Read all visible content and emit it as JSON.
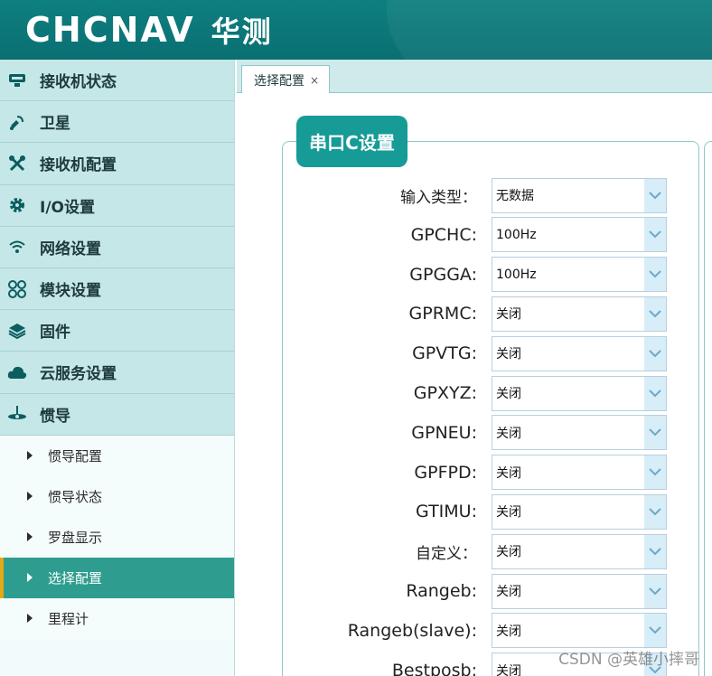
{
  "header": {
    "logo_text": "CHCNAV",
    "logo_cn": "华测"
  },
  "sidebar": {
    "items": [
      {
        "label": "接收机状态",
        "icon": "receiver-icon"
      },
      {
        "label": "卫星",
        "icon": "satellite-icon"
      },
      {
        "label": "接收机配置",
        "icon": "tools-icon"
      },
      {
        "label": "I/O设置",
        "icon": "gear-icon"
      },
      {
        "label": "网络设置",
        "icon": "wifi-icon"
      },
      {
        "label": "模块设置",
        "icon": "modules-icon"
      },
      {
        "label": "固件",
        "icon": "layers-icon"
      },
      {
        "label": "云服务设置",
        "icon": "cloud-icon"
      },
      {
        "label": "惯导",
        "icon": "ins-icon"
      }
    ],
    "sub_items": [
      {
        "label": "惯导配置",
        "active": false
      },
      {
        "label": "惯导状态",
        "active": false
      },
      {
        "label": "罗盘显示",
        "active": false
      },
      {
        "label": "选择配置",
        "active": true
      },
      {
        "label": "里程计",
        "active": false
      }
    ]
  },
  "tabs": [
    {
      "label": "选择配置",
      "close": "×"
    }
  ],
  "panel": {
    "legend": "串口C设置",
    "fields": [
      {
        "label": "输入类型：",
        "value": "无数据"
      },
      {
        "label": "GPCHC:",
        "value": "100Hz"
      },
      {
        "label": "GPGGA:",
        "value": "100Hz"
      },
      {
        "label": "GPRMC:",
        "value": "关闭"
      },
      {
        "label": "GPVTG:",
        "value": "关闭"
      },
      {
        "label": "GPXYZ:",
        "value": "关闭"
      },
      {
        "label": "GPNEU:",
        "value": "关闭"
      },
      {
        "label": "GPFPD:",
        "value": "关闭"
      },
      {
        "label": "GTIMU:",
        "value": "关闭"
      },
      {
        "label": "自定义：",
        "value": "关闭"
      },
      {
        "label": "Rangeb:",
        "value": "关闭"
      },
      {
        "label": "Rangeb(slave):",
        "value": "关闭"
      },
      {
        "label": "Bestposb:",
        "value": "关闭"
      }
    ]
  },
  "watermark": "CSDN @英雄小摔哥",
  "colors": {
    "header": "#0e7f80",
    "accent": "#169b97",
    "active_sub": "#2e9d8f",
    "active_marker": "#e6a817",
    "menu_bg": "#c6e7e8"
  }
}
